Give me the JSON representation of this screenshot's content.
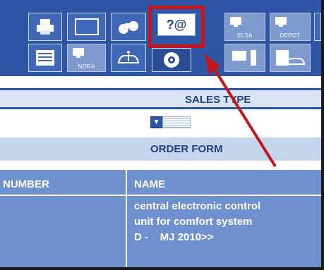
{
  "toolbar": {
    "buttons_row1": [
      {
        "icon": "printer-icon"
      },
      {
        "icon": "window-frame-icon"
      },
      {
        "icon": "binoculars-icon"
      }
    ],
    "help_button": {
      "icon": "help-at-icon",
      "label": "?@"
    },
    "buttons_right": [
      {
        "icon": "monitor-icon",
        "label": "ELSA"
      },
      {
        "icon": "monitor-icon",
        "label": "DEPOT"
      }
    ],
    "buttons_row2": [
      {
        "icon": "list-icon"
      },
      {
        "icon": "monitor-icon",
        "label": "NORA"
      },
      {
        "icon": "car-info-icon"
      },
      {
        "icon": "wheel-icon"
      },
      {
        "icon": "monitor-tower-icon"
      },
      {
        "icon": "car-document-icon"
      }
    ]
  },
  "sales_type": {
    "title": "SALES TYPE"
  },
  "order_form": {
    "title": "ORDER FORM"
  },
  "table": {
    "headers": [
      "NUMBER",
      "NAME"
    ],
    "rows": [
      {
        "number": "",
        "name_lines": [
          "central electronic control",
          "unit for comfort system",
          "D -    MJ 2010>>"
        ]
      }
    ]
  },
  "colors": {
    "toolbar": "#2e56a4",
    "highlight": "#c2161d",
    "table": "#6f90cf"
  }
}
